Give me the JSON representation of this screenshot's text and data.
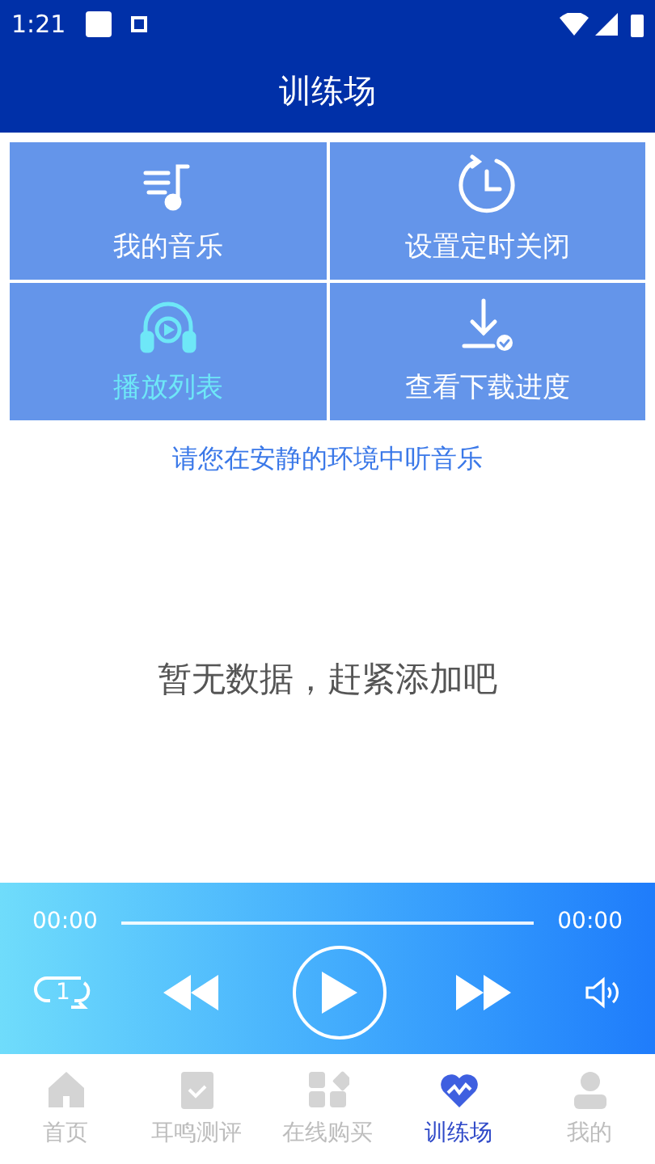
{
  "status_bar": {
    "time": "1:21"
  },
  "title": "训练场",
  "tiles": [
    {
      "label": "我的音乐",
      "kind": "music",
      "selected": false
    },
    {
      "label": "设置定时关闭",
      "kind": "timer",
      "selected": false
    },
    {
      "label": "播放列表",
      "kind": "headphones",
      "selected": true
    },
    {
      "label": "查看下载进度",
      "kind": "download",
      "selected": false
    }
  ],
  "hint": "请您在安静的环境中听音乐",
  "empty_message": "暂无数据，赶紧添加吧",
  "player": {
    "elapsed": "00:00",
    "duration": "00:00",
    "repeat_count": "1"
  },
  "tabs": [
    {
      "label": "首页",
      "kind": "home",
      "selected": false
    },
    {
      "label": "耳鸣测评",
      "kind": "clipboard",
      "selected": false
    },
    {
      "label": "在线购买",
      "kind": "apps",
      "selected": false
    },
    {
      "label": "训练场",
      "kind": "heart",
      "selected": true
    },
    {
      "label": "我的",
      "kind": "user",
      "selected": false
    }
  ]
}
